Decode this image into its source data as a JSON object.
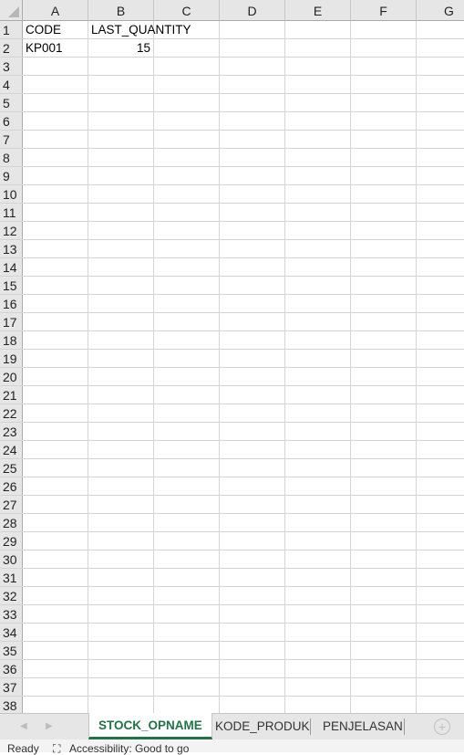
{
  "columns": [
    "A",
    "B",
    "C",
    "D",
    "E",
    "F",
    "G"
  ],
  "rows": [
    {
      "num": "1",
      "cells": [
        "CODE",
        "LAST_QUANTITY",
        "",
        "",
        "",
        "",
        ""
      ]
    },
    {
      "num": "2",
      "cells": [
        "KP001",
        "15",
        "",
        "",
        "",
        "",
        ""
      ]
    },
    {
      "num": "3"
    },
    {
      "num": "4"
    },
    {
      "num": "5"
    },
    {
      "num": "6"
    },
    {
      "num": "7"
    },
    {
      "num": "8"
    },
    {
      "num": "9"
    },
    {
      "num": "10"
    },
    {
      "num": "11"
    },
    {
      "num": "12"
    },
    {
      "num": "13"
    },
    {
      "num": "14"
    },
    {
      "num": "15"
    },
    {
      "num": "16"
    },
    {
      "num": "17"
    },
    {
      "num": "18"
    },
    {
      "num": "19"
    },
    {
      "num": "20"
    },
    {
      "num": "21"
    },
    {
      "num": "22"
    },
    {
      "num": "23"
    },
    {
      "num": "24"
    },
    {
      "num": "25"
    },
    {
      "num": "26"
    },
    {
      "num": "27"
    },
    {
      "num": "28"
    },
    {
      "num": "29"
    },
    {
      "num": "30"
    },
    {
      "num": "31"
    },
    {
      "num": "32"
    },
    {
      "num": "33"
    },
    {
      "num": "34"
    },
    {
      "num": "35"
    },
    {
      "num": "36"
    },
    {
      "num": "37"
    },
    {
      "num": "38"
    }
  ],
  "sheet_tabs": [
    {
      "label": "STOCK_OPNAME",
      "active": true
    },
    {
      "label": "KODE_PRODUK",
      "active": false
    },
    {
      "label": "PENJELASAN",
      "active": false
    }
  ],
  "nav": {
    "prev_icon": "◀",
    "next_icon": "▶",
    "add_icon": "+"
  },
  "status": {
    "ready": "Ready",
    "accessibility_icon": "⛶",
    "accessibility": "Accessibility: Good to go"
  },
  "accent_color": "#217346"
}
